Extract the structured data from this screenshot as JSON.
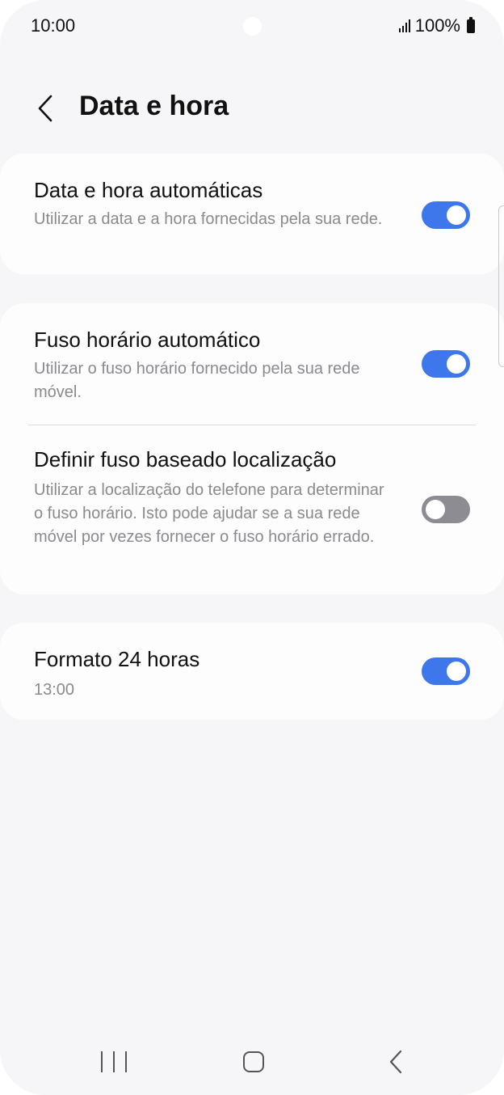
{
  "status_bar": {
    "time": "10:00",
    "battery": "100%",
    "icons": [
      "signal-icon",
      "battery-icon"
    ]
  },
  "header": {
    "back_icon": "chevron-left-icon",
    "title": "Data e hora"
  },
  "settings": {
    "auto_datetime": {
      "title": "Data e hora automáticas",
      "description": "Utilizar a data e a hora fornecidas pela sua rede.",
      "enabled": true
    },
    "auto_timezone": {
      "title": "Fuso horário automático",
      "description": "Utilizar o fuso horário fornecido pela sua rede móvel.",
      "enabled": true
    },
    "location_timezone": {
      "title": "Definir fuso baseado localização",
      "description": "Utilizar a localização do telefone para determinar o fuso horário. Isto pode ajudar se a sua rede móvel por vezes fornecer o fuso horário errado.",
      "enabled": false
    },
    "format_24h": {
      "title": "Formato 24 horas",
      "description": "13:00",
      "enabled": true
    }
  },
  "nav_bar": {
    "icons": [
      "recents-icon",
      "home-icon",
      "back-icon"
    ]
  },
  "colors": {
    "background": "#f6f6f8",
    "card": "#fdfdfe",
    "toggle_on": "#3e76ec",
    "toggle_off": "#8c8c92",
    "secondary_text": "#8a8a8f"
  }
}
